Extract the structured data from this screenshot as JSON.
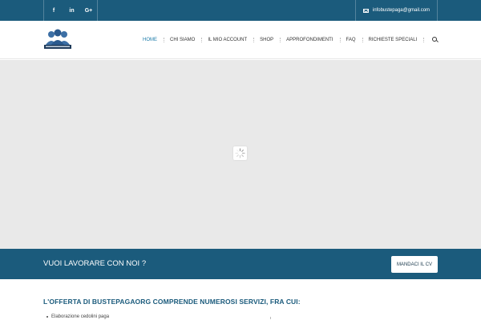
{
  "topbar": {
    "social": [
      {
        "name": "facebook",
        "label": "f"
      },
      {
        "name": "linkedin",
        "label": "in"
      },
      {
        "name": "googleplus",
        "label": "G+"
      }
    ],
    "email": "infobustepaga@gmail.com"
  },
  "header": {
    "logo_alt": "bustepaga.org logo",
    "nav": [
      {
        "id": "home",
        "label": "HOME",
        "active": true
      },
      {
        "id": "chi-siamo",
        "label": "CHI SIAMO",
        "active": false
      },
      {
        "id": "il-mio-account",
        "label": "IL MIO ACCOUNT",
        "active": false
      },
      {
        "id": "shop",
        "label": "SHOP",
        "active": false
      },
      {
        "id": "approfondimenti",
        "label": "APPROFONDIMENTI",
        "active": false
      },
      {
        "id": "faq",
        "label": "FAQ",
        "active": false
      },
      {
        "id": "richieste-speciali",
        "label": "RICHIESTE SPECIALI",
        "active": false
      }
    ]
  },
  "cta": {
    "text": "VUOI LAVORARE CON NOI ?",
    "button": "MANDACI IL CV"
  },
  "offer": {
    "title": "L'OFFERTA DI BUSTEPAGAORG COMPRENDE NUMEROSI SERVIZI, FRA CUI:",
    "items": [
      "Elaborazione cedolini paga"
    ]
  },
  "colors": {
    "primary": "#1b5b7c",
    "accent": "#1b7aa8",
    "slider_bg": "#e9e9e9"
  }
}
